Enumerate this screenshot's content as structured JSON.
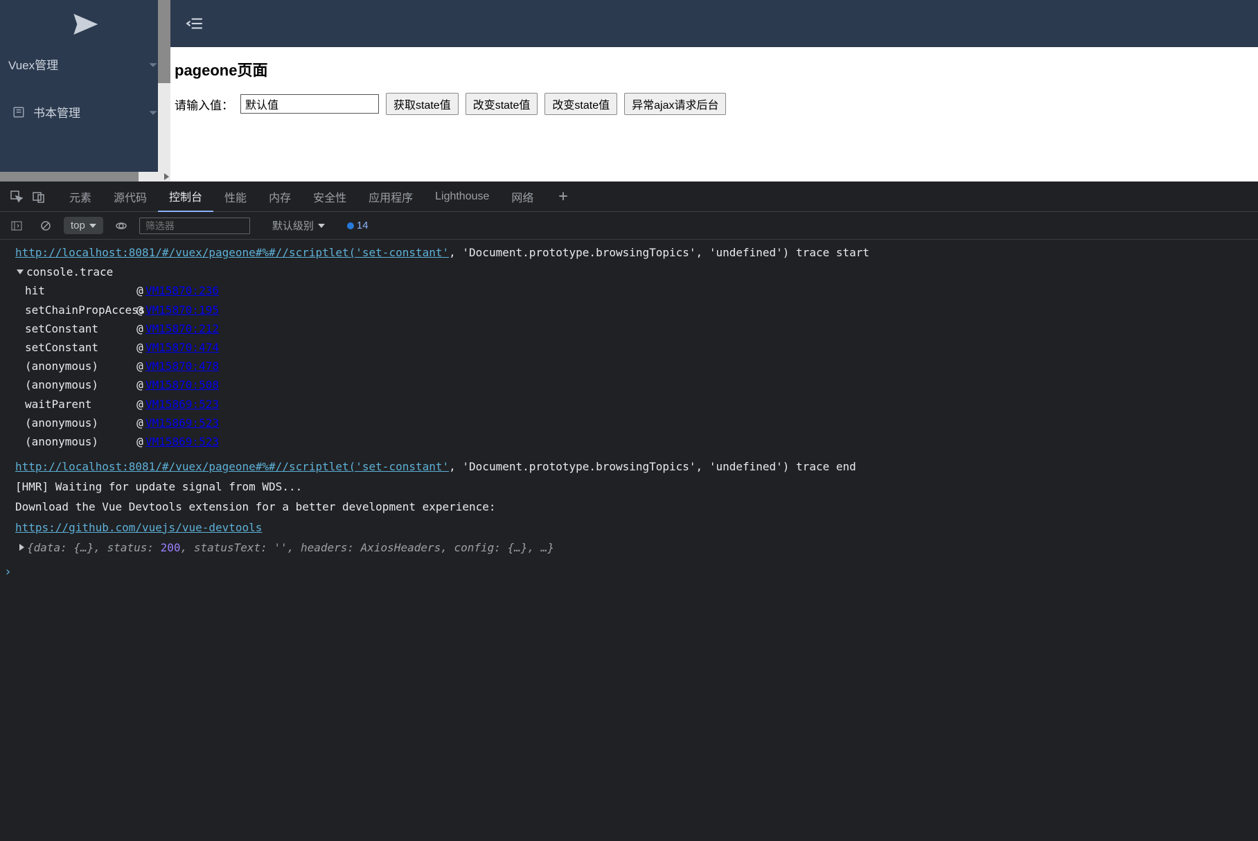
{
  "sidebar": {
    "items": [
      {
        "label": "Vuex管理",
        "icon": ""
      },
      {
        "label": "书本管理",
        "icon": "book"
      }
    ]
  },
  "header": {},
  "page": {
    "title": "pageone页面",
    "input_label": "请输入值：",
    "input_value": "默认值",
    "btn_get": "获取state值",
    "btn_set1": "改变state值",
    "btn_set2": "改变state值",
    "btn_ajax": "异常ajax请求后台"
  },
  "devtools": {
    "tabs": [
      "元素",
      "源代码",
      "控制台",
      "性能",
      "内存",
      "安全性",
      "应用程序",
      "Lighthouse",
      "网络"
    ],
    "activeTab": 2,
    "ctx": "top",
    "filter_ph": "筛选器",
    "level": "默认级别",
    "msgCount": "14"
  },
  "console": {
    "url1_a": "http://localhost:8081/#/vuex/pageone#%#//scriptlet('set-constant'",
    "url1_b": ", 'Document.prototype.browsingTopics', 'undefined') trace start",
    "trace_label": "console.trace",
    "trace": [
      {
        "fn": "hit",
        "loc": "VM15870:236"
      },
      {
        "fn": "setChainPropAccess",
        "loc": "VM15870:195"
      },
      {
        "fn": "setConstant",
        "loc": "VM15870:212"
      },
      {
        "fn": "setConstant",
        "loc": "VM15870:474"
      },
      {
        "fn": "(anonymous)",
        "loc": "VM15870:478"
      },
      {
        "fn": "(anonymous)",
        "loc": "VM15870:508"
      },
      {
        "fn": "waitParent",
        "loc": "VM15869:523"
      },
      {
        "fn": "(anonymous)",
        "loc": "VM15869:523"
      },
      {
        "fn": "(anonymous)",
        "loc": "VM15869:523"
      }
    ],
    "url2_a": "http://localhost:8081/#/vuex/pageone#%#//scriptlet('set-constant'",
    "url2_b": ", 'Document.prototype.browsingTopics', 'undefined') trace end",
    "hmr": "[HMR] Waiting for update signal from WDS...",
    "vuedl1": "Download the Vue Devtools extension for a better development experience:",
    "vuedl2": "https://github.com/vuejs/vue-devtools",
    "obj_pre": "{data: {…}, status: ",
    "obj_200": "200",
    "obj_post": ", statusText: '', headers: AxiosHeaders, config: {…}, …}"
  }
}
